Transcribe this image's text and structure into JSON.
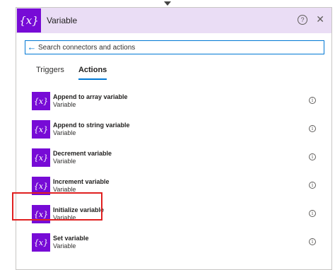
{
  "header": {
    "badge": "{x}",
    "title": "Variable",
    "help_glyph": "?",
    "close_glyph": "✕"
  },
  "search": {
    "back_glyph": "←",
    "placeholder": "Search connectors and actions",
    "value": ""
  },
  "tabs": [
    {
      "label": "Triggers",
      "active": false
    },
    {
      "label": "Actions",
      "active": true
    }
  ],
  "actions": [
    {
      "icon": "{x}",
      "name": "Append to array variable",
      "connector": "Variable"
    },
    {
      "icon": "{x}",
      "name": "Append to string variable",
      "connector": "Variable"
    },
    {
      "icon": "{x}",
      "name": "Decrement variable",
      "connector": "Variable"
    },
    {
      "icon": "{x}",
      "name": "Increment variable",
      "connector": "Variable"
    },
    {
      "icon": "{x}",
      "name": "Initialize variable",
      "connector": "Variable",
      "highlighted": true
    },
    {
      "icon": "{x}",
      "name": "Set variable",
      "connector": "Variable"
    }
  ],
  "info_glyph": "i",
  "colors": {
    "header_bg": "#eaddf5",
    "badge_bg": "#770bd6",
    "accent": "#0078d4",
    "highlight": "#e02020"
  }
}
